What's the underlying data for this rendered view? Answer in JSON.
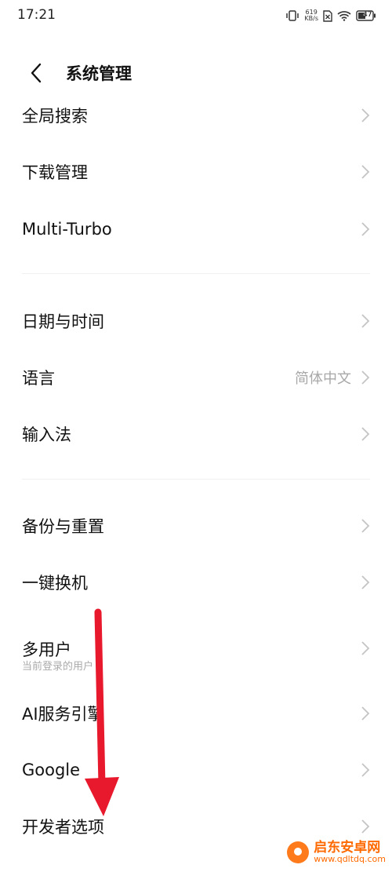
{
  "status_bar": {
    "time": "17:21",
    "net_speed_value": "619",
    "net_speed_unit": "KB/s",
    "battery": "47"
  },
  "header": {
    "title": "系统管理"
  },
  "groups": [
    [
      {
        "label": "全局搜索"
      },
      {
        "label": "下载管理"
      },
      {
        "label": "Multi-Turbo"
      }
    ],
    [
      {
        "label": "日期与时间"
      },
      {
        "label": "语言",
        "value": "简体中文"
      },
      {
        "label": "输入法"
      }
    ],
    [
      {
        "label": "备份与重置"
      },
      {
        "label": "一键换机"
      },
      {
        "label": "多用户",
        "sub": "当前登录的用户"
      },
      {
        "label": "AI服务引擎"
      },
      {
        "label": "Google"
      },
      {
        "label": "开发者选项"
      }
    ]
  ],
  "watermark": {
    "title": "启东安卓网",
    "url": "www.qdltdq.com"
  },
  "colors": {
    "annotation_arrow": "#e8192c",
    "chevron": "#c4c4c4",
    "watermark": "#ff6a00"
  }
}
